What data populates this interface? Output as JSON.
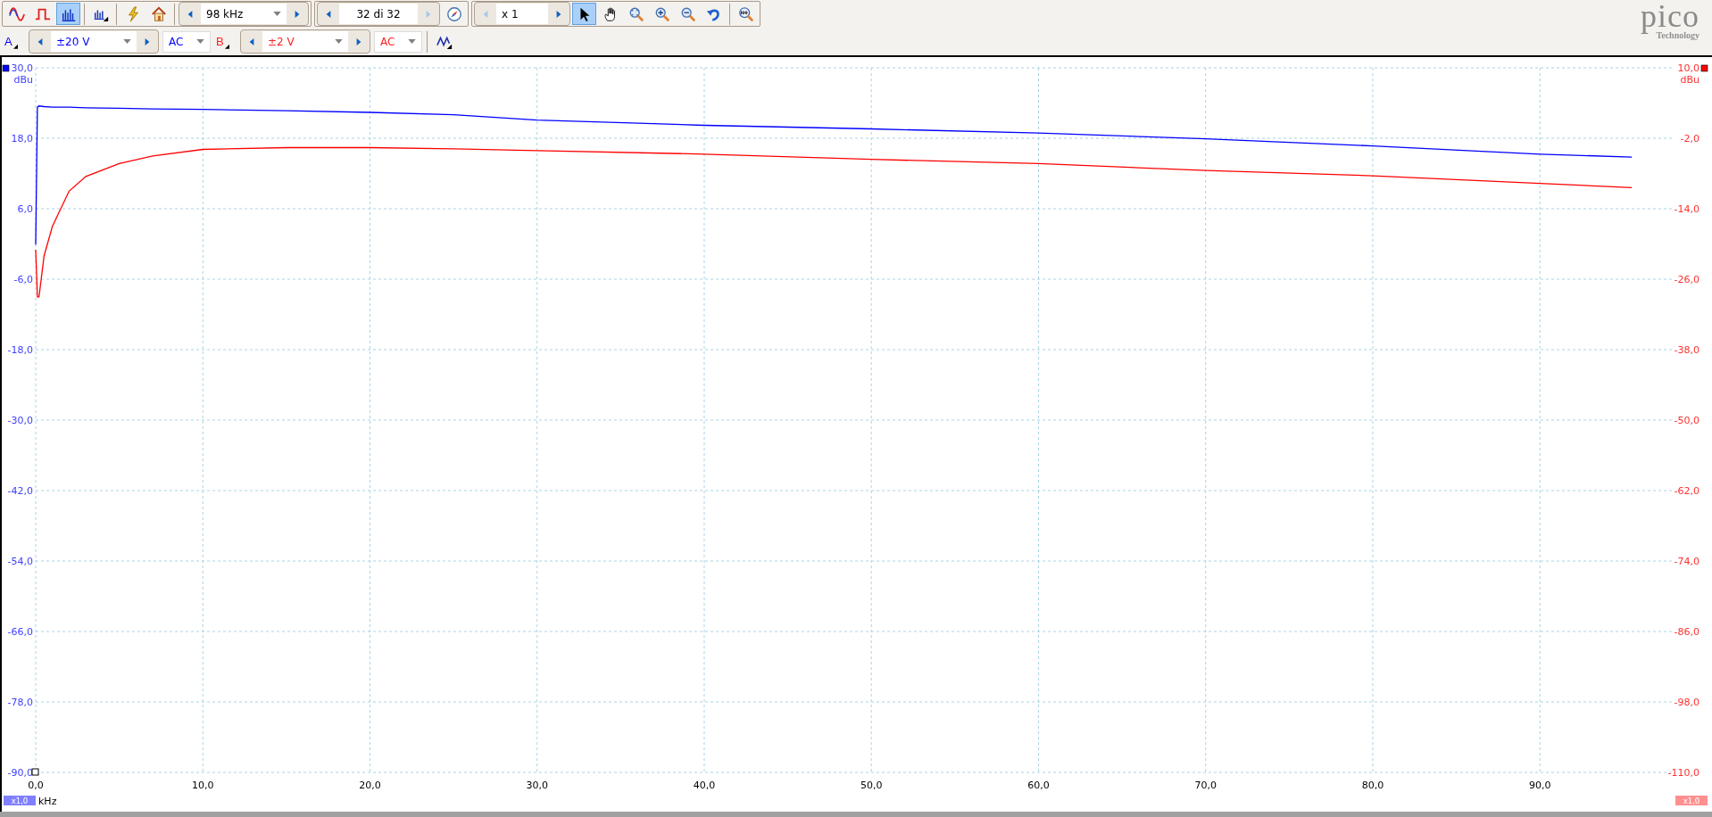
{
  "toolbar_top": [
    {
      "kind": "panel",
      "items": [
        {
          "kind": "tool",
          "selected": false
        },
        {
          "kind": "tool",
          "selected": false
        },
        {
          "kind": "tool",
          "selected": true
        },
        {
          "kind": "separator"
        },
        {
          "kind": "tool",
          "selected": false
        },
        {
          "kind": "separator"
        },
        {
          "kind": "tool",
          "selected": false
        },
        {
          "kind": "tool",
          "selected": false
        },
        {
          "kind": "separator"
        },
        {
          "kind": "spinner",
          "value": "98 kHz",
          "dropdown": true,
          "prev_disabled": false,
          "next_disabled": false
        }
      ]
    },
    {
      "kind": "panel",
      "items": [
        {
          "kind": "spinner",
          "value": "32 di 32",
          "dropdown": false,
          "prev_disabled": false,
          "next_disabled": true
        },
        {
          "kind": "tool",
          "selected": false
        }
      ]
    },
    {
      "kind": "panel",
      "items": [
        {
          "kind": "spinner",
          "value": "x 1",
          "dropdown": false,
          "prev_disabled": true,
          "next_disabled": false
        },
        {
          "kind": "tool",
          "selected": true
        },
        {
          "kind": "tool",
          "selected": false
        },
        {
          "kind": "tool",
          "selected": false
        },
        {
          "kind": "tool",
          "selected": false
        },
        {
          "kind": "tool",
          "selected": false
        },
        {
          "kind": "tool",
          "selected": false
        },
        {
          "kind": "separator"
        },
        {
          "kind": "tool",
          "selected": false
        }
      ]
    }
  ],
  "channels": [
    {
      "label": "A",
      "color": "#0000ff",
      "range": "±20 V",
      "coupling": "AC"
    },
    {
      "label": "B",
      "color": "#ff2020",
      "range": "±2 V",
      "coupling": "AC"
    }
  ],
  "logo": {
    "name": "pico",
    "tagline": "Technology"
  },
  "plot": {
    "left_badge": "x1,0",
    "right_badge": "x1,0",
    "chart_data": {
      "type": "line",
      "grid": true,
      "xlabel": "kHz",
      "ylabel": "dBu",
      "y2label": "dBu",
      "xlim": [
        0,
        98
      ],
      "ylim": [
        -90,
        30
      ],
      "y2lim": [
        -110,
        10
      ],
      "y2ticks": [
        {
          "value": 10,
          "label": "10,0"
        },
        {
          "value": -2,
          "label": "-2,0"
        },
        {
          "value": -14,
          "label": "-14,0"
        },
        {
          "value": -26,
          "label": "-26,0"
        },
        {
          "value": -38,
          "label": "-38,0"
        },
        {
          "value": -50,
          "label": "-50,0"
        },
        {
          "value": -62,
          "label": "-62,0"
        },
        {
          "value": -74,
          "label": "-74,0"
        },
        {
          "value": -86,
          "label": "-86,0"
        },
        {
          "value": -98,
          "label": "-98,0"
        },
        {
          "value": -110,
          "label": "-110,0"
        }
      ],
      "xticks": [
        {
          "value": 0,
          "label": "0,0"
        },
        {
          "value": 10,
          "label": "10,0"
        },
        {
          "value": 20,
          "label": "20,0"
        },
        {
          "value": 30,
          "label": "30,0"
        },
        {
          "value": 40,
          "label": "40,0"
        },
        {
          "value": 50,
          "label": "50,0"
        },
        {
          "value": 60,
          "label": "60,0"
        },
        {
          "value": 70,
          "label": "70,0"
        },
        {
          "value": 80,
          "label": "80,0"
        },
        {
          "value": 90,
          "label": "90,0"
        }
      ],
      "yticks": [
        {
          "value": 30,
          "label": "30,0"
        },
        {
          "value": 18,
          "label": "18,0"
        },
        {
          "value": 6,
          "label": "6,0"
        },
        {
          "value": -6,
          "label": "-6,0"
        },
        {
          "value": -18,
          "label": "-18,0"
        },
        {
          "value": -30,
          "label": "-30,0"
        },
        {
          "value": -42,
          "label": "-42,0"
        },
        {
          "value": -54,
          "label": "-54,0"
        },
        {
          "value": -66,
          "label": "-66,0"
        },
        {
          "value": -78,
          "label": "-78,0"
        },
        {
          "value": -90,
          "label": "-90,0"
        }
      ],
      "x": [
        0,
        0.1,
        0.2,
        0.5,
        1,
        2,
        3,
        5,
        7,
        10,
        15,
        20,
        25,
        30,
        40,
        50,
        60,
        70,
        80,
        90,
        95.5
      ],
      "series": [
        {
          "color": "#0000ff",
          "values": [
            -0.1,
            23.3,
            23.5,
            23.4,
            23.3,
            23.3,
            23.2,
            23.1,
            23.0,
            22.9,
            22.7,
            22.4,
            22.0,
            21.1,
            20.2,
            19.6,
            18.9,
            17.9,
            16.7,
            15.3,
            14.8
          ]
        },
        {
          "color": "#ff0000",
          "axis": "y2",
          "values": [
            -21,
            -29,
            -29,
            -22,
            -17,
            -11,
            -8.5,
            -6.3,
            -5,
            -3.9,
            -3.6,
            -3.6,
            -3.8,
            -4.1,
            -4.7,
            -5.6,
            -6.3,
            -7.5,
            -8.4,
            -9.7,
            -10.4
          ]
        }
      ]
    }
  }
}
